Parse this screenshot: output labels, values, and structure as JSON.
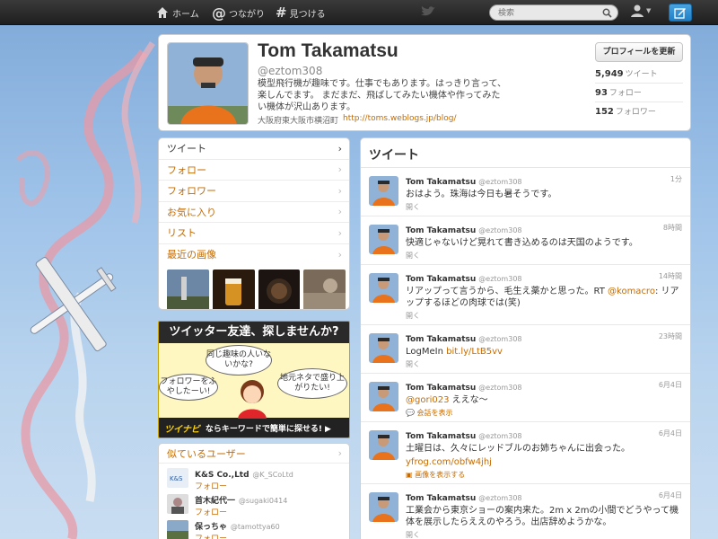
{
  "nav": {
    "home": "ホーム",
    "connect": "つながり",
    "discover": "見つける",
    "search_placeholder": "検索"
  },
  "profile": {
    "name": "Tom Takamatsu",
    "handle": "@eztom308",
    "bio": "模型飛行機が趣味です。仕事でもあります。はっきり言って、楽しんでます。 まだまだ、飛ばしてみたい機体や作ってみたい機体が沢山あります。",
    "location": "大阪府東大阪市横沼町",
    "url": "http://toms.weblogs.jp/blog/",
    "edit_button": "プロフィールを更新",
    "tweets_count": "5,949",
    "tweets_label": "ツイート",
    "following_count": "93",
    "following_label": "フォロー",
    "followers_count": "152",
    "followers_label": "フォロワー"
  },
  "leftnav": {
    "items": [
      {
        "label": "ツイート"
      },
      {
        "label": "フォロー"
      },
      {
        "label": "フォロワー"
      },
      {
        "label": "お気に入り"
      },
      {
        "label": "リスト"
      },
      {
        "label": "最近の画像"
      }
    ]
  },
  "ad": {
    "title": "ツイッター友達、探しませんか?",
    "bubble1": "同じ趣味の人いないかな?",
    "bubble2": "フォロワーをふやしたーい!",
    "bubble3": "地元ネタで盛り上がりたい!",
    "brand": "ツイナビ",
    "footer": "ならキーワードで簡単に探せる! ▶"
  },
  "suggestions": {
    "title": "似ているユーザー",
    "users": [
      {
        "name": "K&S Co.,Ltd",
        "handle": "@K_SCoLtd",
        "follow": "フォロー"
      },
      {
        "name": "首木紀代一",
        "handle": "@sugaki0414",
        "follow": "フォロー"
      },
      {
        "name": "保っちゃ",
        "handle": "@tamottya60",
        "follow": "フォロー"
      }
    ]
  },
  "timeline": {
    "title": "ツイート",
    "tweets": [
      {
        "name": "Tom Takamatsu",
        "handle": "@eztom308",
        "time": "1分",
        "text": "おはよう。珠海は今日も暑そうです。",
        "link": "",
        "action": "開く",
        "action2": ""
      },
      {
        "name": "Tom Takamatsu",
        "handle": "@eztom308",
        "time": "8時間",
        "text": "快適じゃないけど晃れて書き込めるのは天国のようです。",
        "link": "",
        "action": "開く",
        "action2": ""
      },
      {
        "name": "Tom Takamatsu",
        "handle": "@eztom308",
        "time": "14時間",
        "text": "リアップって言うから、毛生え薬かと思った。RT ",
        "link": "@komacro",
        "text2": ": リアップするほどの肉球では(笑)",
        "action": "開く",
        "action2": ""
      },
      {
        "name": "Tom Takamatsu",
        "handle": "@eztom308",
        "time": "23時間",
        "text": "LogMeIn ",
        "link": "bit.ly/LtB5vv",
        "action": "開く",
        "action2": ""
      },
      {
        "name": "Tom Takamatsu",
        "handle": "@eztom308",
        "time": "6月4日",
        "text": "",
        "link": "@gori023",
        "text2": " ええな～",
        "action": "",
        "action2": "会話を表示"
      },
      {
        "name": "Tom Takamatsu",
        "handle": "@eztom308",
        "time": "6月4日",
        "text": "土曜日は、久々にレッドブルのお姉ちゃんに出会った。",
        "link": "yfrog.com/obfw4jhj",
        "action": "",
        "action2": "画像を表示する"
      },
      {
        "name": "Tom Takamatsu",
        "handle": "@eztom308",
        "time": "6月4日",
        "text": "工業会から東京ショーの案内来た。2m x 2mの小間でどうやって機体を展示したらええのやろう。出店辞めようかな。",
        "link": "",
        "action": "開く",
        "action2": ""
      }
    ]
  },
  "colors": {
    "link": "#c66b00",
    "topbar": "#2a2a2a",
    "sky": "#9cc1e8",
    "compose": "#1f7fc6"
  },
  "icons": {
    "home": "home-icon",
    "connect": "at-icon",
    "discover": "hash-icon",
    "search": "search-icon",
    "user": "user-icon",
    "compose": "compose-icon",
    "chevron": "chevron-right-icon"
  }
}
